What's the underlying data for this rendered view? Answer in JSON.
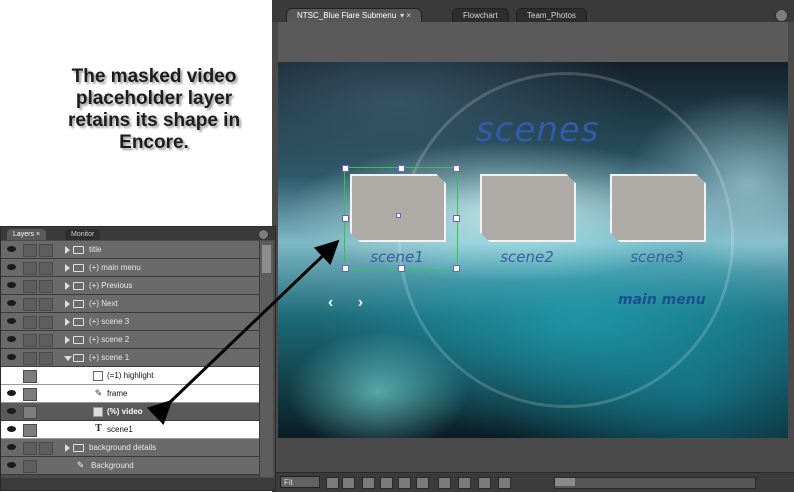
{
  "caption": {
    "line1": "The masked video",
    "line2": "placeholder layer",
    "line3": "retains its shape in",
    "line4": "Encore."
  },
  "monitor": {
    "tabs": [
      {
        "label": "NTSC_Blue Flare Submenu",
        "active": true
      },
      {
        "label": "Flowchart",
        "active": false
      },
      {
        "label": "Team_Photos",
        "active": false
      }
    ],
    "close_glyph": "▾ ×",
    "menu": {
      "title": "scenes",
      "buttons": [
        "scene1",
        "scene2",
        "scene3"
      ],
      "nav_arrows": "‹ ›",
      "main_menu_link": "main menu"
    },
    "status": {
      "zoom": "Fit"
    }
  },
  "layers_panel": {
    "tabs": [
      {
        "label": "Layers",
        "active": true
      },
      {
        "label": "Monitor",
        "active": false
      }
    ],
    "rows": [
      {
        "label": "title",
        "type": "folder",
        "expanded": false
      },
      {
        "label": "(+) main menu",
        "type": "folder",
        "expanded": false
      },
      {
        "label": "(+) Previous",
        "type": "folder",
        "expanded": false
      },
      {
        "label": "(+) Next",
        "type": "folder",
        "expanded": false
      },
      {
        "label": "(+) scene 3",
        "type": "folder",
        "expanded": false
      },
      {
        "label": "(+) scene 2",
        "type": "folder",
        "expanded": false
      },
      {
        "label": "(+) scene 1",
        "type": "folder",
        "expanded": true
      },
      {
        "label": "(=1) highlight",
        "type": "child"
      },
      {
        "label": "frame",
        "type": "child"
      },
      {
        "label": "(%) video",
        "type": "child",
        "selected": true
      },
      {
        "label": "scene1",
        "type": "child"
      },
      {
        "label": "background details",
        "type": "folder",
        "expanded": false
      },
      {
        "label": "Background",
        "type": "layer"
      }
    ]
  },
  "colors": {
    "menu_text": "#2f5da8",
    "selection_box": "#36c24a",
    "panel_bg": "#4b4b4b"
  }
}
